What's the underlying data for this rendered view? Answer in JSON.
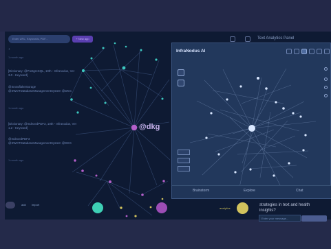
{
  "header": {
    "search_placeholder": "Enter URL, Keywords, PDF...",
    "new_button": "+ New app",
    "text_panel_title": "Text Analytics Panel",
    "close_icon": "✕"
  },
  "feed": {
    "items": [
      {
        "text": "+"
      },
      {
        "time": "1 month ago"
      },
      {
        "text": "[Dictionary: @PostgreSQL, 10th - Infranodus, Ver 3.0 - Keyword]"
      },
      {
        "text": "@SnowflakeStorage @SWOTDatabaseManagementSystem @DKG"
      },
      {
        "time": "1 month ago"
      },
      {
        "text": "[Dictionary: @IndexedPDF3, 10th - Infranodus, Ver 1.2 - Keyword]"
      },
      {
        "text": "@IndexedPDF3 @SWOTDatabaseManagementSystem @DKG"
      },
      {
        "time": "1 month ago"
      }
    ]
  },
  "graph": {
    "center_label": "@dkg"
  },
  "dialog": {
    "title": "InfraNodus AI",
    "footer_left": "Brainstorm",
    "footer_middle": "Explore",
    "footer_right": "Chat"
  },
  "bottom": {
    "left_text_1": "add",
    "left_text_2": "import",
    "prompt_line": "strategies in text and health insights?",
    "input_placeholder": "Enter your message...",
    "tag_text": "analytics"
  },
  "colors": {
    "background": "#262b4d",
    "dialog": "#22385c",
    "accent": "#9c4db5",
    "teal": "#3cc7bf",
    "yellow": "#d2c35d",
    "graph_lines": "#7fa7e8"
  }
}
